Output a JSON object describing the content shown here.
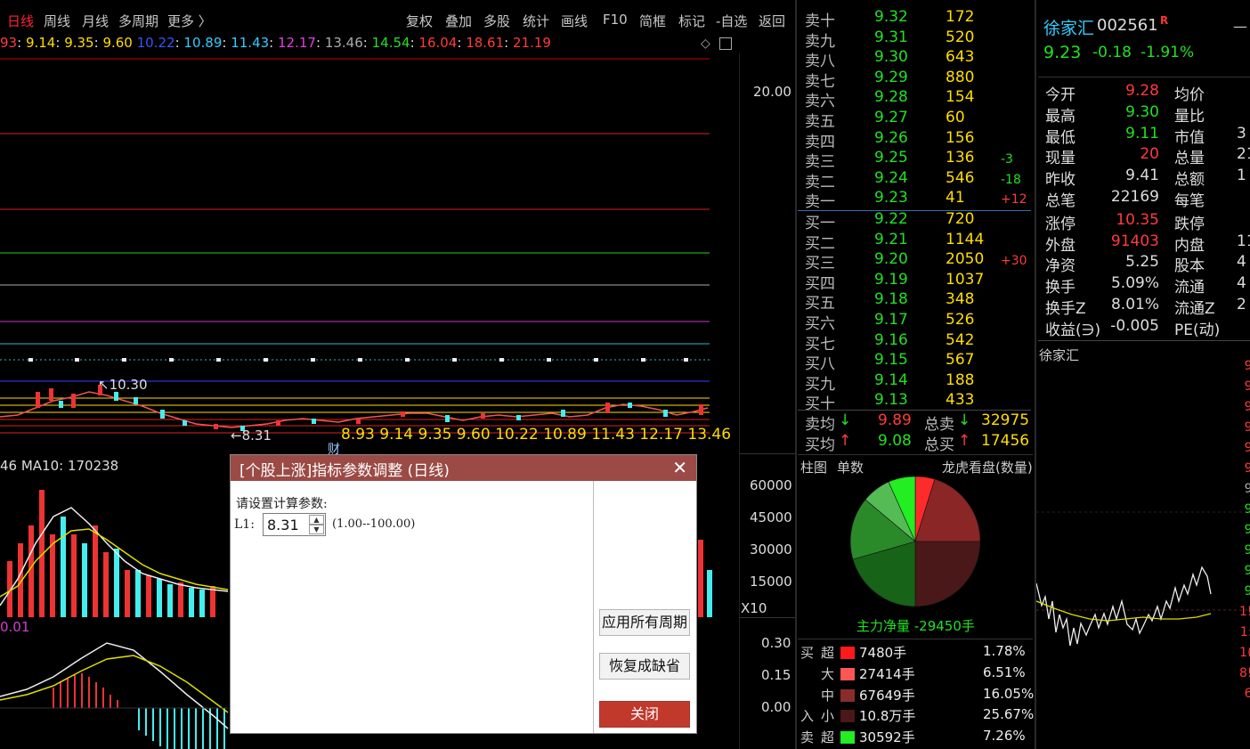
{
  "toolbar": {
    "left": [
      "日线",
      "周线",
      "月线",
      "多周期",
      "更多 〉"
    ],
    "right": [
      "复权",
      "叠加",
      "多股",
      "统计",
      "画线",
      "F10",
      "简框",
      "标记",
      "-自选",
      "返回"
    ]
  },
  "price_levels": [
    "93",
    "9.14",
    "9.35",
    "9.60",
    "10.22",
    "10.89",
    "11.43",
    "12.17",
    "13.46",
    "14.54",
    "16.04",
    "18.61",
    "21.19"
  ],
  "price_axis": {
    "top": "20.00"
  },
  "chart_labels": {
    "high": "10.30",
    "low": "8.31",
    "cai": "财",
    "bottom_levels": [
      "8.93",
      "9.14",
      "9.35",
      "9.60",
      "10.22",
      "10.89",
      "11.43",
      "12.17",
      "13.46"
    ]
  },
  "volume": {
    "label": "46 MA10: 170238",
    "axis": [
      "60000",
      "45000",
      "30000",
      "15000",
      "X10"
    ]
  },
  "macd": {
    "label": "0.01",
    "axis": [
      "0.30",
      "0.15",
      "0.00"
    ]
  },
  "orderbook": {
    "sells": [
      {
        "l": "卖十",
        "p": "9.32",
        "v": "172",
        "d": ""
      },
      {
        "l": "卖九",
        "p": "9.31",
        "v": "520",
        "d": ""
      },
      {
        "l": "卖八",
        "p": "9.30",
        "v": "643",
        "d": ""
      },
      {
        "l": "卖七",
        "p": "9.29",
        "v": "880",
        "d": ""
      },
      {
        "l": "卖六",
        "p": "9.28",
        "v": "154",
        "d": ""
      },
      {
        "l": "卖五",
        "p": "9.27",
        "v": "60",
        "d": ""
      },
      {
        "l": "卖四",
        "p": "9.26",
        "v": "156",
        "d": ""
      },
      {
        "l": "卖三",
        "p": "9.25",
        "v": "136",
        "d": "-3"
      },
      {
        "l": "卖二",
        "p": "9.24",
        "v": "546",
        "d": "-18"
      },
      {
        "l": "卖一",
        "p": "9.23",
        "v": "41",
        "d": "+12"
      }
    ],
    "buys": [
      {
        "l": "买一",
        "p": "9.22",
        "v": "720",
        "d": ""
      },
      {
        "l": "买二",
        "p": "9.21",
        "v": "1144",
        "d": ""
      },
      {
        "l": "买三",
        "p": "9.20",
        "v": "2050",
        "d": "+30"
      },
      {
        "l": "买四",
        "p": "9.19",
        "v": "1037",
        "d": ""
      },
      {
        "l": "买五",
        "p": "9.18",
        "v": "348",
        "d": ""
      },
      {
        "l": "买六",
        "p": "9.17",
        "v": "526",
        "d": ""
      },
      {
        "l": "买七",
        "p": "9.16",
        "v": "542",
        "d": ""
      },
      {
        "l": "买八",
        "p": "9.15",
        "v": "567",
        "d": ""
      },
      {
        "l": "买九",
        "p": "9.14",
        "v": "188",
        "d": ""
      },
      {
        "l": "买十",
        "p": "9.13",
        "v": "433",
        "d": ""
      }
    ],
    "avg": [
      {
        "l": "卖均",
        "p": "9.89",
        "t": "总卖",
        "v": "32975"
      },
      {
        "l": "买均",
        "p": "9.08",
        "t": "总买",
        "v": "17456"
      }
    ]
  },
  "flow": {
    "tabs": [
      "柱图",
      "单数",
      "龙虎看盘(数量)"
    ],
    "net": "主力净量 -29450手",
    "rows": [
      {
        "side": "买",
        "type": "超",
        "color": "#ff1a1a",
        "qty": "7480手",
        "pct": "1.78%"
      },
      {
        "side": "",
        "type": "大",
        "color": "#f55",
        "qty": "27414手",
        "pct": "6.51%"
      },
      {
        "side": "",
        "type": "中",
        "color": "#8b2c2c",
        "qty": "67649手",
        "pct": "16.05%"
      },
      {
        "side": "入",
        "type": "小",
        "color": "#4a1818",
        "qty": "10.8万手",
        "pct": "25.67%"
      },
      {
        "side": "卖",
        "type": "超",
        "color": "#22ee22",
        "qty": "30592手",
        "pct": "7.26%"
      }
    ]
  },
  "stock": {
    "name": "徐家汇",
    "code": "002561",
    "badge": "R",
    "price": "9.23",
    "chg": "-0.18",
    "pct": "-1.91%",
    "mini_label": "徐家汇",
    "stats": [
      {
        "a": "今开",
        "av": "9.28",
        "b": "均价",
        "bv": ""
      },
      {
        "a": "最高",
        "av": "9.30",
        "b": "量比",
        "bv": ""
      },
      {
        "a": "最低",
        "av": "9.11",
        "b": "市值",
        "bv": "3"
      },
      {
        "a": "现量",
        "av": "20",
        "b": "总量",
        "bv": "21"
      },
      {
        "a": "昨收",
        "av": "9.41",
        "b": "总额",
        "bv": "1"
      },
      {
        "a": "总笔",
        "av": "22169",
        "b": "每笔",
        "bv": ""
      },
      {
        "a": "涨停",
        "av": "10.35",
        "b": "跌停",
        "bv": ""
      },
      {
        "a": "外盘",
        "av": "91403",
        "b": "内盘",
        "bv": "11"
      },
      {
        "a": "净资",
        "av": "5.25",
        "b": "股本",
        "bv": "4"
      },
      {
        "a": "换手",
        "av": "5.09%",
        "b": "流通",
        "bv": "4"
      },
      {
        "a": "换手Z",
        "av": "8.01%",
        "b": "流通Z",
        "bv": "2"
      },
      {
        "a": "收益(∋)",
        "av": "-0.005",
        "b": "PE(动)",
        "bv": ""
      }
    ]
  },
  "dialog": {
    "title": "[个股上涨]指标参数调整 (日线)",
    "prompt": "请设置计算参数:",
    "param_label": "L1:",
    "param_value": "8.31",
    "range": "(1.00--100.00)",
    "btn_apply": "应用所有周期",
    "btn_reset": "恢复成缺省",
    "btn_close": "关闭"
  }
}
